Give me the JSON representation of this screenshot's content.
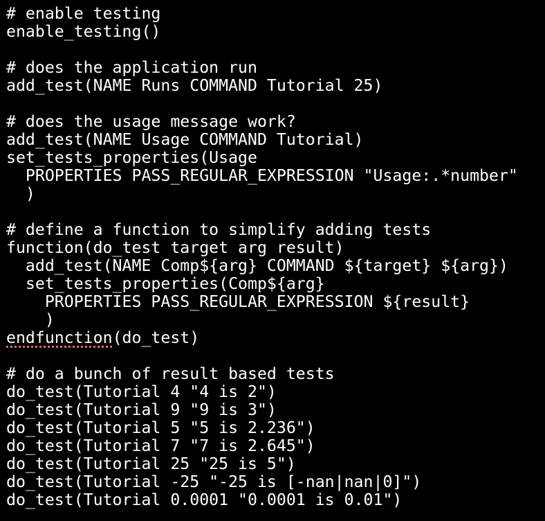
{
  "editor": {
    "lines": [
      "# enable testing",
      "enable_testing()",
      "",
      "# does the application run",
      "add_test(NAME Runs COMMAND Tutorial 25)",
      "",
      "# does the usage message work?",
      "add_test(NAME Usage COMMAND Tutorial)",
      "set_tests_properties(Usage",
      "  PROPERTIES PASS_REGULAR_EXPRESSION \"Usage:.*number\"",
      "  )",
      "",
      "# define a function to simplify adding tests",
      "function(do_test target arg result)",
      "  add_test(NAME Comp${arg} COMMAND ${target} ${arg})",
      "  set_tests_properties(Comp${arg}",
      "    PROPERTIES PASS_REGULAR_EXPRESSION ${result}",
      "    )",
      "",
      "",
      "# do a bunch of result based tests",
      "do_test(Tutorial 4 \"4 is 2\")",
      "do_test(Tutorial 9 \"9 is 3\")",
      "do_test(Tutorial 5 \"5 is 2.236\")",
      "do_test(Tutorial 7 \"7 is 2.645\")",
      "do_test(Tutorial 25 \"25 is 5\")",
      "do_test(Tutorial -25 \"-25 is [-nan|nan|0]\")",
      "do_test(Tutorial 0.0001 \"0.0001 is 0.01\")"
    ],
    "endfunction_keyword": "endfunction",
    "endfunction_rest": "(do_test)"
  },
  "colors": {
    "background": "#000000",
    "text": "#ffffff",
    "spellcheck_underline": "#e06c75"
  }
}
